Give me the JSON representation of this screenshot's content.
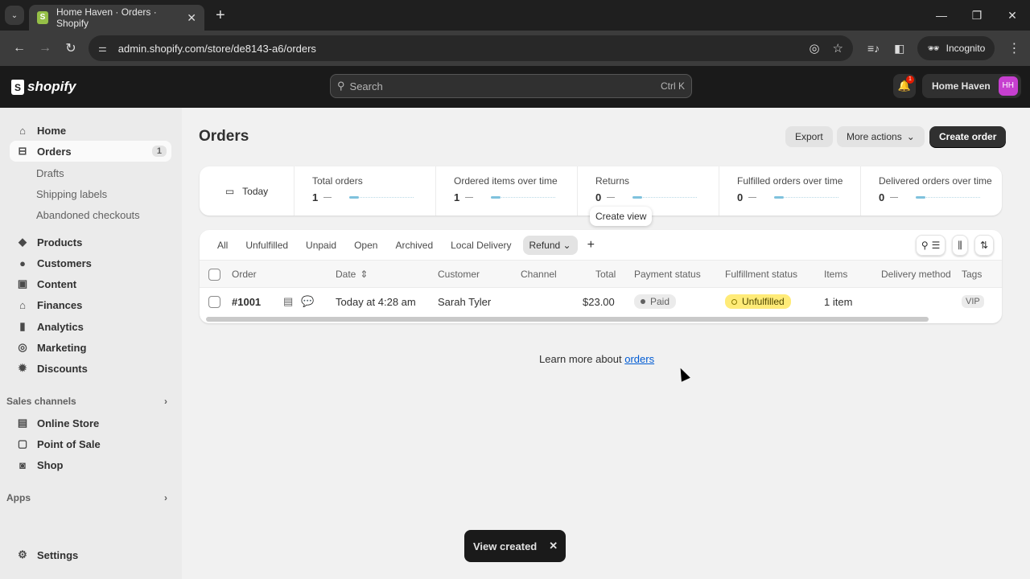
{
  "browser": {
    "tab_title": "Home Haven · Orders · Shopify",
    "url": "admin.shopify.com/store/de8143-a6/orders",
    "incognito_label": "Incognito"
  },
  "topbar": {
    "logo_text": "shopify",
    "search_placeholder": "Search",
    "search_shortcut": "Ctrl K",
    "notification_count": "1",
    "store_name": "Home Haven",
    "avatar_initials": "HH",
    "avatar_color": "#c73fd0"
  },
  "sidebar": {
    "items": [
      {
        "label": "Home",
        "icon": "home-icon"
      },
      {
        "label": "Orders",
        "icon": "inbox-icon",
        "badge": "1",
        "active": true
      },
      {
        "label": "Products",
        "icon": "tag-icon"
      },
      {
        "label": "Customers",
        "icon": "person-icon"
      },
      {
        "label": "Content",
        "icon": "content-icon"
      },
      {
        "label": "Finances",
        "icon": "bank-icon"
      },
      {
        "label": "Analytics",
        "icon": "bar-chart-icon"
      },
      {
        "label": "Marketing",
        "icon": "target-icon"
      },
      {
        "label": "Discounts",
        "icon": "discount-icon"
      }
    ],
    "order_subitems": [
      "Drafts",
      "Shipping labels",
      "Abandoned checkouts"
    ],
    "sales_channels_label": "Sales channels",
    "sales_channels": [
      {
        "label": "Online Store",
        "icon": "store-icon"
      },
      {
        "label": "Point of Sale",
        "icon": "pos-icon"
      },
      {
        "label": "Shop",
        "icon": "shop-icon"
      }
    ],
    "apps_label": "Apps",
    "settings_label": "Settings"
  },
  "page": {
    "title": "Orders",
    "export_label": "Export",
    "more_actions_label": "More actions",
    "create_order_label": "Create order"
  },
  "metrics": {
    "date_label": "Today",
    "cards": [
      {
        "label": "Total orders",
        "value": "1"
      },
      {
        "label": "Ordered items over time",
        "value": "1"
      },
      {
        "label": "Returns",
        "value": "0"
      },
      {
        "label": "Fulfilled orders over time",
        "value": "0"
      },
      {
        "label": "Delivered orders over time",
        "value": "0"
      }
    ]
  },
  "tooltip": "Create view",
  "views": {
    "tabs": [
      "All",
      "Unfulfilled",
      "Unpaid",
      "Open",
      "Archived",
      "Local Delivery",
      "Refund"
    ],
    "active": "Refund"
  },
  "table": {
    "columns": [
      "Order",
      "Date",
      "Customer",
      "Channel",
      "Total",
      "Payment status",
      "Fulfillment status",
      "Items",
      "Delivery method",
      "Tags"
    ],
    "rows": [
      {
        "order": "#1001",
        "date": "Today at 4:28 am",
        "customer": "Sarah Tyler",
        "channel": "",
        "total": "$23.00",
        "payment_status": "Paid",
        "fulfillment_status": "Unfulfilled",
        "items": "1 item",
        "delivery_method": "",
        "tags": "VIP"
      }
    ]
  },
  "footer": {
    "learn_text": "Learn more about ",
    "learn_link": "orders"
  },
  "toast": {
    "message": "View created"
  }
}
